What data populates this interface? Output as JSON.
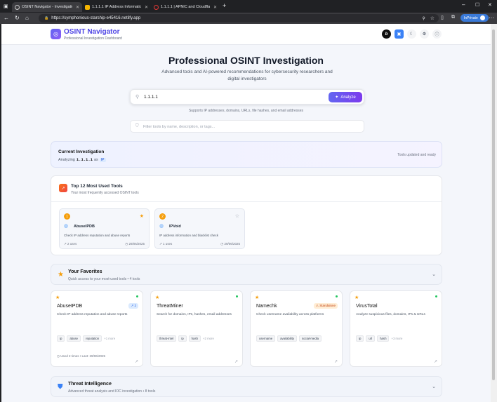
{
  "browser": {
    "tabs": [
      {
        "title": "OSINT Navigator - Investigation I...",
        "active": true
      },
      {
        "title": "1.1.1.1 IP Address Information | IP...",
        "active": false
      },
      {
        "title": "1.1.1.1 | APNIC and Cloudflare DN...",
        "active": false
      }
    ],
    "url": "https://symphonious-starship-e45416.netlify.app",
    "inprivate_label": "InPrivate"
  },
  "header": {
    "brand": "OSINT Navigator",
    "subtitle": "Professional Investigation Dashboard",
    "buttons": [
      "b"
    ]
  },
  "hero": {
    "title": "Professional OSINT Investigation",
    "lead": "Advanced tools and AI-powered recommendations for cybersecurity researchers and digital investigators"
  },
  "search": {
    "value": "1.1.1.1",
    "button_label": "Analyze",
    "supports_text": "Supports IP addresses, domains, URLs, file hashes, and email addresses"
  },
  "filter": {
    "placeholder": "Filter tools by name, description, or tags..."
  },
  "current_investigation": {
    "title": "Current Investigation",
    "analyzing_prefix": "Analyzing",
    "target": "1.1.1.1",
    "as_word": "as",
    "type": "IP",
    "status": "Tools updated and ready"
  },
  "top_tools": {
    "title": "Top 12 Most Used Tools",
    "subtitle": "Your most frequently accessed OSINT tools",
    "items": [
      {
        "rank": "1",
        "name": "AbuseIPDB",
        "desc": "Check IP address reputation and abuse reports",
        "uses": "2 uses",
        "date": "29/06/2025",
        "starred": true
      },
      {
        "rank": "2",
        "name": "IPVoid",
        "desc": "IP address information and blacklist check",
        "uses": "1 uses",
        "date": "29/06/2025",
        "starred": false
      }
    ]
  },
  "favorites": {
    "title": "Your Favorites",
    "subtitle": "Quick access to your most-used tools • 4 tools",
    "cards": [
      {
        "name": "AbuseIPDB",
        "desc": "Check IP address reputation and abuse reports",
        "badge": "2",
        "tags": [
          "ip",
          "abuse",
          "reputation"
        ],
        "more": "+1 more",
        "footer": "Used 2 times • Last: 29/06/2025"
      },
      {
        "name": "ThreatMiner",
        "desc": "Search for domains, IPs, hashes, email addresses",
        "badge": "",
        "tags": [
          "threat-intel",
          "ip",
          "hash"
        ],
        "more": "+2 more",
        "footer": ""
      },
      {
        "name": "Namechk",
        "desc": "Check username availability across platforms",
        "badge": "Standalone",
        "tags": [
          "username",
          "availability",
          "social-media"
        ],
        "more": "",
        "footer": ""
      },
      {
        "name": "VirusTotal",
        "desc": "Analyze suspicious files, domains, IPs & URLs",
        "badge": "",
        "tags": [
          "ip",
          "url",
          "hash"
        ],
        "more": "+3 more",
        "footer": ""
      }
    ]
  },
  "threat_intel": {
    "title": "Threat Intelligence",
    "subtitle": "Advanced threat analysis and IOC investigation • 8 tools"
  },
  "colors": {
    "accent": "#6366f1",
    "brand": "#4f46e5",
    "star": "#f59e0b"
  }
}
